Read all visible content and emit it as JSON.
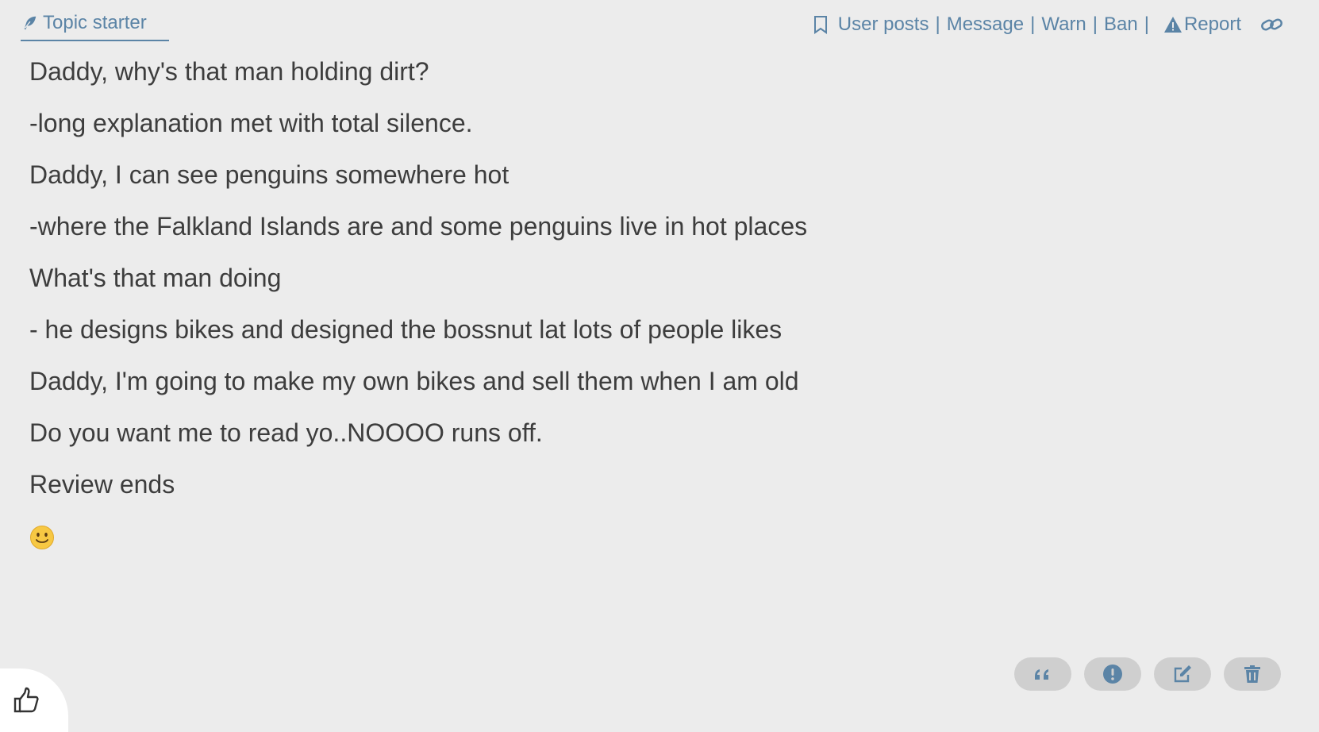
{
  "header": {
    "topic_starter_label": "Topic starter",
    "actions": {
      "user_posts": "User posts",
      "message": "Message",
      "warn": "Warn",
      "ban": "Ban",
      "report": "Report",
      "separator": "|"
    }
  },
  "post": {
    "lines": [
      "Daddy, why's that man holding dirt?",
      "-long explanation met with total silence.",
      "Daddy, I can see penguins somewhere hot",
      "-where the Falkland Islands are and some penguins live in hot places",
      "What's that man doing",
      "- he designs bikes and designed the bossnut lat lots of people likes",
      "Daddy, I'm going to make my own bikes and sell them when I am old",
      "Do you want me to read yo..NOOOO runs off.",
      "Review ends"
    ],
    "emoji": "slightly-smiling-face-icon"
  },
  "footer": {
    "buttons": [
      "quote-icon",
      "exclamation-icon",
      "edit-icon",
      "trash-icon"
    ],
    "like": "thumbs-up-icon"
  },
  "colors": {
    "background": "#ececec",
    "accent": "#5b84a6",
    "text": "#3d3d3d",
    "button_bg": "#cfcfcf"
  }
}
